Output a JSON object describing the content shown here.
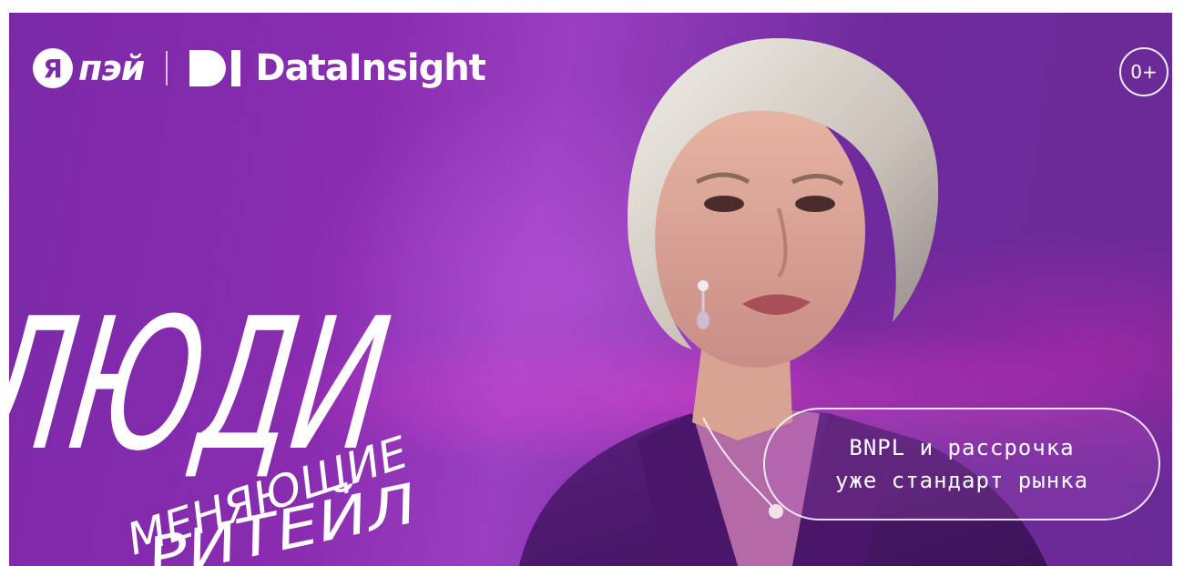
{
  "brand": {
    "yandex_letter": "Я",
    "pay_name": "пэй",
    "partner_name": "DataInsight"
  },
  "age_rating": "0+",
  "headline": {
    "main": "ЛЮДИ",
    "line2": "МЕНЯЮЩИЕ",
    "line3": "РИТЕЙЛ"
  },
  "quote": {
    "line1": "BNPL и рассрочка",
    "line2": "уже стандарт рынка"
  },
  "colors": {
    "background": "#7a2aa8",
    "accent_pink": "#e03cc8",
    "text": "#ffffff"
  },
  "icons": {
    "yandex_pay_logo": "yandex-pay-logo",
    "datainsight_logo": "datainsight-logo"
  }
}
